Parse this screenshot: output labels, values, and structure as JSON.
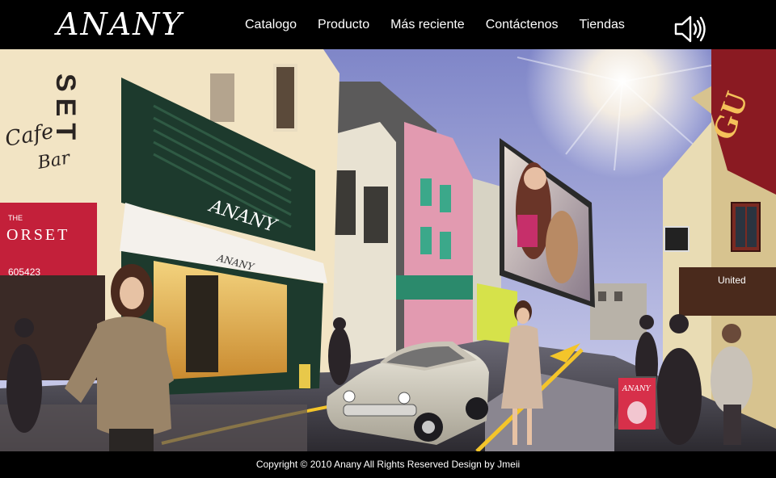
{
  "header": {
    "logo": "ANANY",
    "nav": [
      "Catalogo",
      "Producto",
      "Más reciente",
      "Contáctenos",
      "Tiendas"
    ]
  },
  "scene": {
    "cafe_sign_1": "SET",
    "cafe_sign_2": "Cafe",
    "cafe_sign_3": "Bar",
    "corset_sign": "ORSET",
    "the_label": "THE",
    "phone": "605423",
    "store_sign": "ANANY",
    "awning_text": "ANANY",
    "united_sign": "United",
    "poster_text": "ANANY",
    "gu_sign": "GU"
  },
  "footer": {
    "copyright": "Copyright © 2010 Anany All Rights Reserved Design by Jmeii"
  },
  "colors": {
    "sky_top": "#7f86c8",
    "sky_bottom": "#d3d4ee",
    "header_bg": "#000000",
    "accent_red": "#c3203a"
  }
}
